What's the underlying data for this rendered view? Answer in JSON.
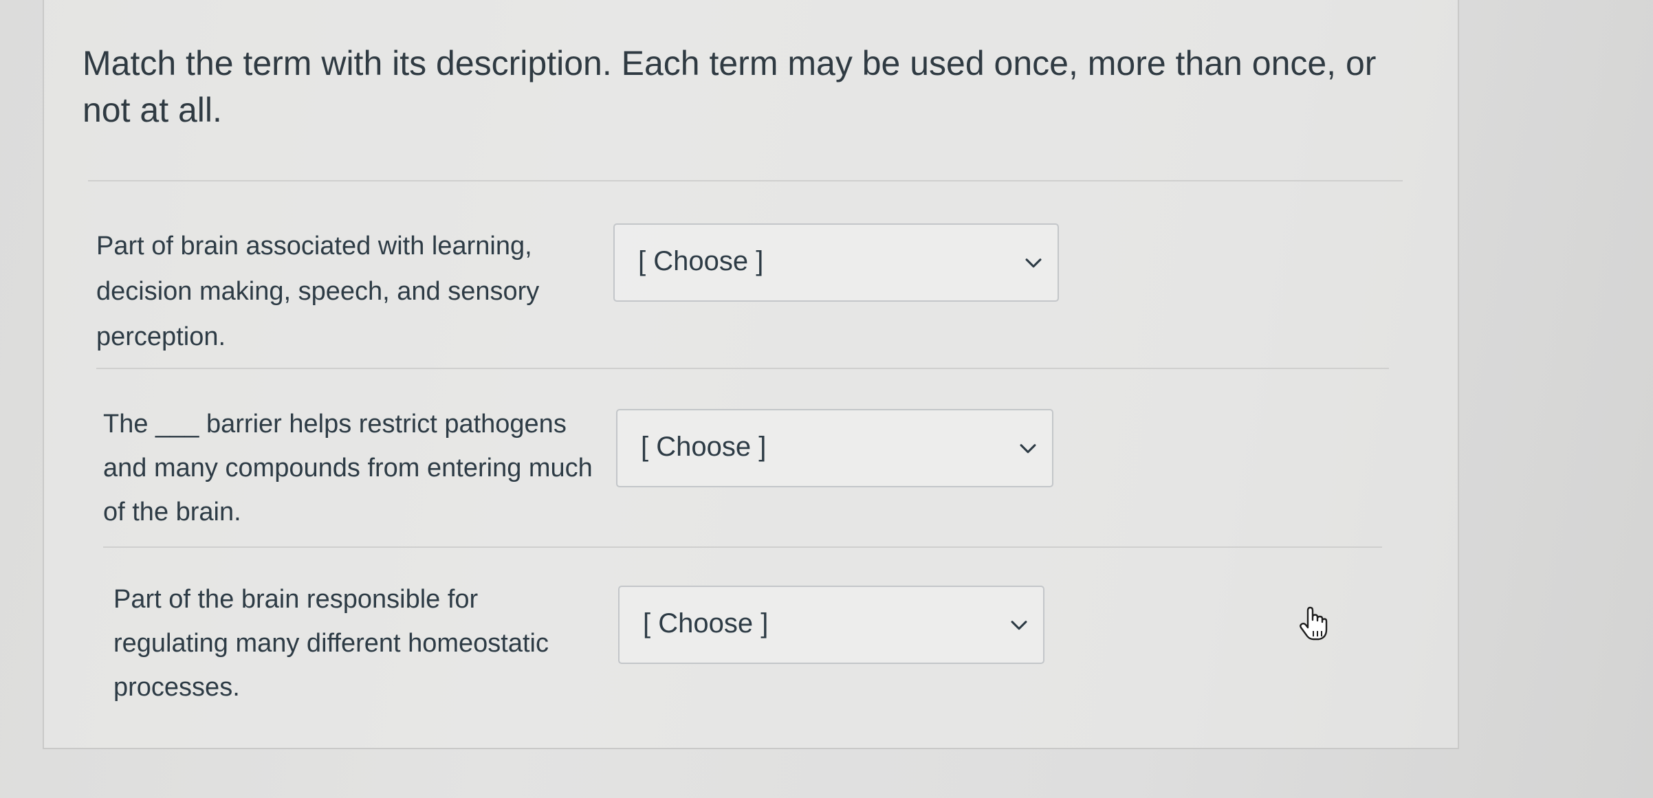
{
  "question": {
    "prompt": "Match the term with its description. Each term may be used once, more than once, or not at all."
  },
  "rows": [
    {
      "description": "Part of brain associated with learning, decision making, speech, and sensory perception.",
      "select_value": "[ Choose ]",
      "chevron_icon": "chevron-down-icon"
    },
    {
      "description": "The ___ barrier helps restrict pathogens and many compounds from entering much of the brain.",
      "select_value": "[ Choose ]",
      "chevron_icon": "chevron-down-icon"
    },
    {
      "description": "Part of the brain responsible for regulating many different homeostatic processes.",
      "select_value": "[ Choose ]",
      "chevron_icon": "chevron-down-icon"
    }
  ],
  "cursor": {
    "icon": "hand-pointer-icon"
  },
  "colors": {
    "text": "#2d3b45",
    "border": "#c3c6c9",
    "background": "#dedede"
  }
}
